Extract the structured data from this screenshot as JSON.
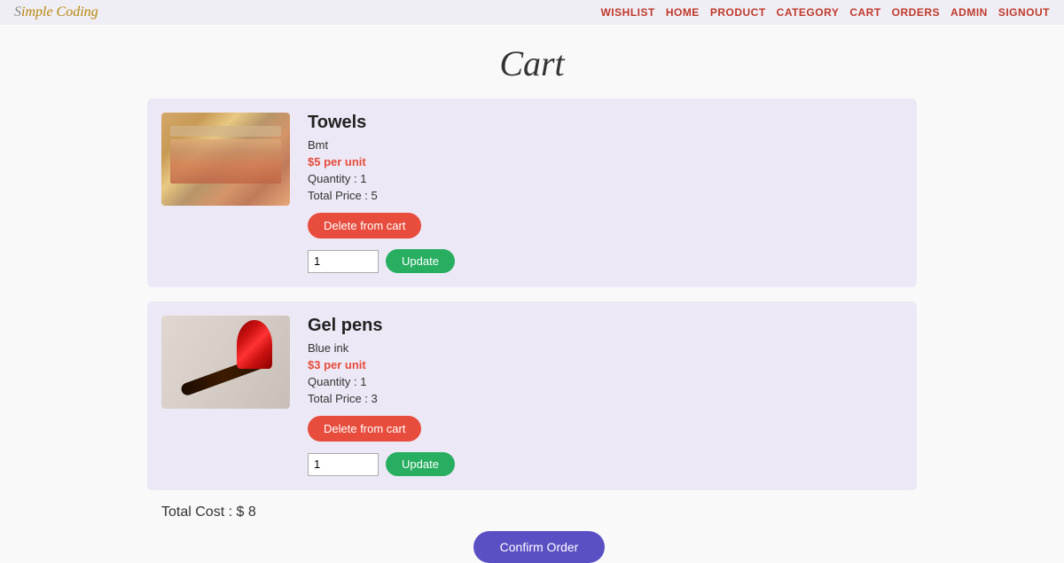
{
  "header": {
    "logo": "Simple Coding",
    "nav_links": [
      {
        "label": "WISHLIST",
        "href": "#"
      },
      {
        "label": "HOME",
        "href": "#"
      },
      {
        "label": "PRODUCT",
        "href": "#"
      },
      {
        "label": "CATEGORY",
        "href": "#"
      },
      {
        "label": "CART",
        "href": "#"
      },
      {
        "label": "ORDERS",
        "href": "#"
      },
      {
        "label": "ADMIN",
        "href": "#"
      },
      {
        "label": "SIGNOUT",
        "href": "#"
      }
    ]
  },
  "page": {
    "title": "Cart"
  },
  "cart": {
    "items": [
      {
        "id": "towels",
        "name": "Towels",
        "brand": "Bmt",
        "price_label": "$5 per unit",
        "quantity_label": "Quantity : 1",
        "total_label": "Total Price : 5",
        "delete_label": "Delete from cart",
        "update_label": "Update",
        "qty_placeholder": "1"
      },
      {
        "id": "gel-pens",
        "name": "Gel pens",
        "brand": "Blue ink",
        "price_label": "$3 per unit",
        "quantity_label": "Quantity : 1",
        "total_label": "Total Price : 3",
        "delete_label": "Delete from cart",
        "update_label": "Update",
        "qty_placeholder": "1"
      }
    ],
    "total_cost_label": "Total Cost : $ 8",
    "confirm_label": "Confirm Order"
  }
}
